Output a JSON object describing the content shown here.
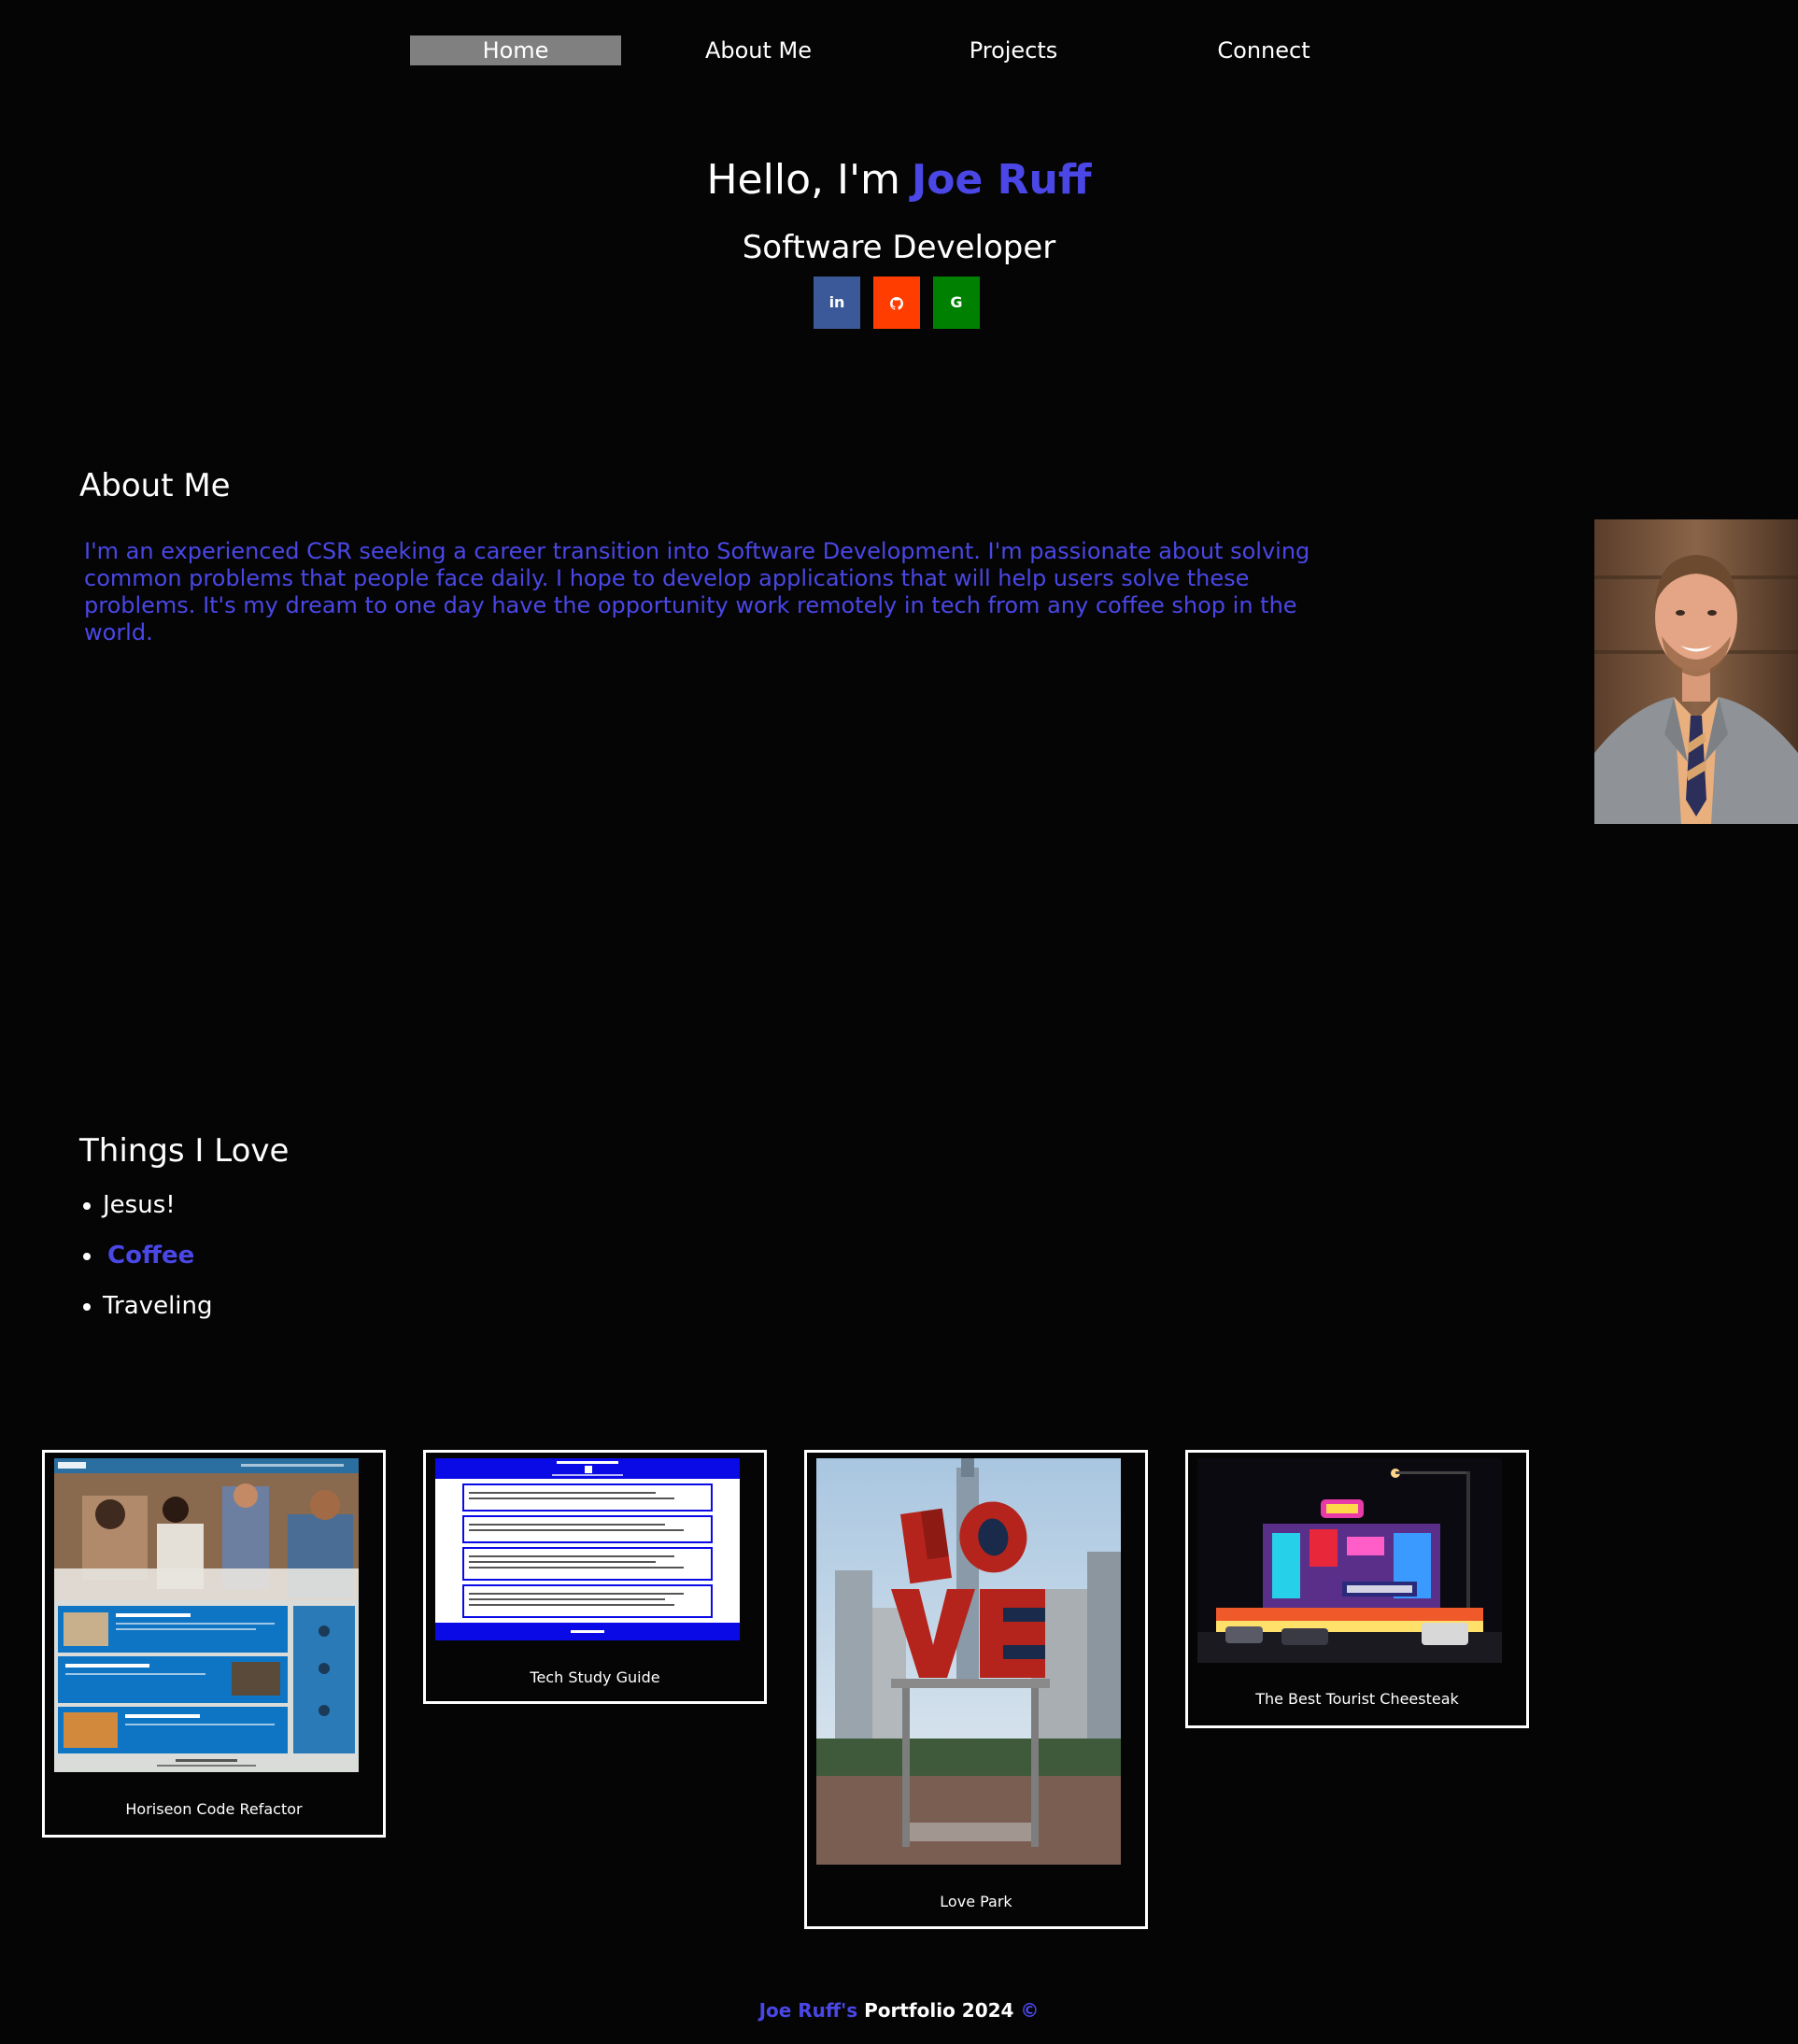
{
  "nav": {
    "items": [
      {
        "label": "Home",
        "active": true
      },
      {
        "label": "About Me",
        "active": false
      },
      {
        "label": "Projects",
        "active": false
      },
      {
        "label": "Connect",
        "active": false
      }
    ]
  },
  "hero": {
    "greeting": "Hello, I'm",
    "name": "Joe Ruff",
    "subtitle": "Software Developer",
    "socials": [
      {
        "label": "in",
        "icon": "linkedin-icon",
        "color": "#3b5998"
      },
      {
        "label": "",
        "icon": "github-icon",
        "color": "#ff3d00"
      },
      {
        "label": "G",
        "icon": "google-icon",
        "color": "#008000"
      }
    ]
  },
  "about": {
    "title": "About Me",
    "text": "I'm an experienced CSR seeking a career transition into Software Development. I'm passionate about solving common problems that people face daily. I hope to develop applications that will help users solve these problems. It's my dream to one day have the opportunity work remotely in tech from any coffee shop in the world."
  },
  "love": {
    "title": "Things I Love",
    "items": [
      "Jesus!",
      "Coffee",
      "Traveling"
    ]
  },
  "projects": [
    {
      "caption": "Horiseon Code Refactor"
    },
    {
      "caption": "Tech Study Guide"
    },
    {
      "caption": "Love Park"
    },
    {
      "caption": "The Best Tourist Cheesteak"
    }
  ],
  "footer": {
    "name": "Joe Ruff's",
    "text": "Portfolio 2024",
    "symbol": "©"
  },
  "colors": {
    "accent": "#4a47e6",
    "background": "#050505",
    "nav_active": "#808080"
  }
}
